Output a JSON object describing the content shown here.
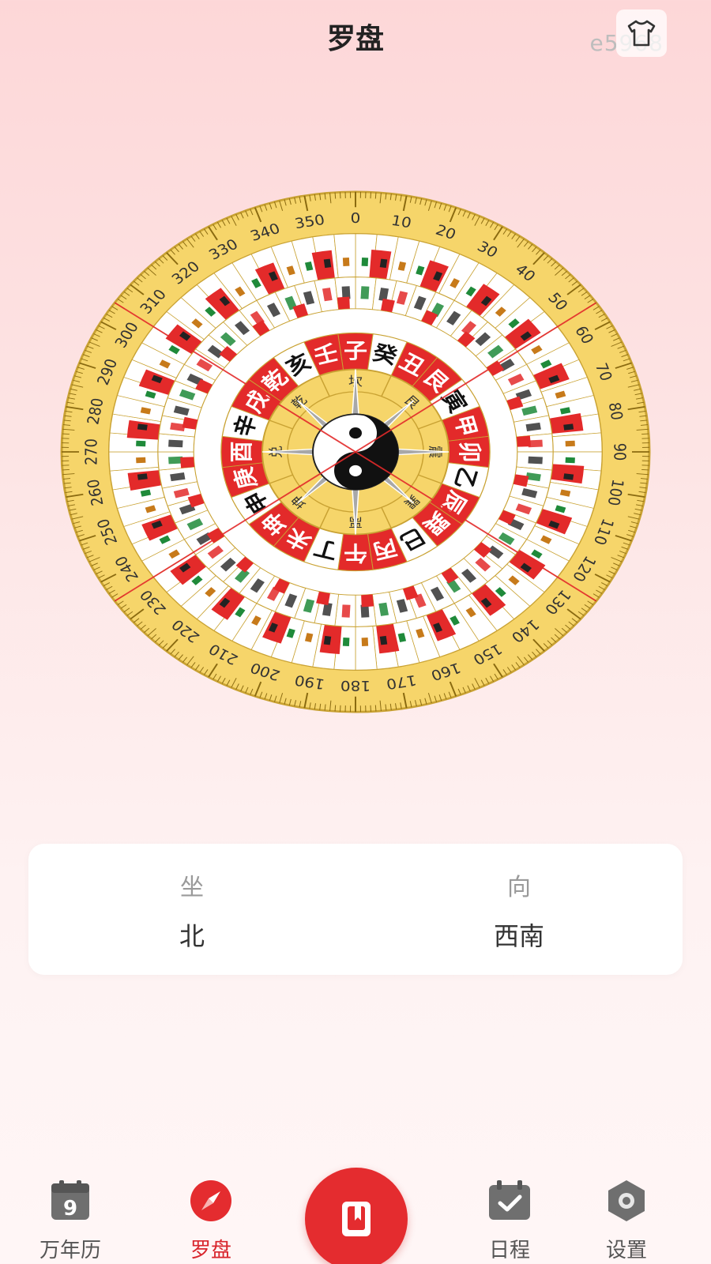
{
  "header": {
    "title": "罗盘",
    "watermark": "e5968"
  },
  "compass": {
    "degree_labels": [
      "0",
      "10",
      "20",
      "30",
      "40",
      "50",
      "60",
      "70",
      "80",
      "90",
      "100",
      "110",
      "120",
      "130",
      "140",
      "150",
      "160",
      "170",
      "180",
      "190",
      "200",
      "210",
      "220",
      "230",
      "240",
      "250",
      "260",
      "270",
      "280",
      "290",
      "300",
      "310",
      "320",
      "330",
      "340",
      "350"
    ],
    "mountains": [
      "子",
      "癸",
      "丑",
      "艮",
      "寅",
      "甲",
      "卯",
      "乙",
      "辰",
      "巽",
      "巳",
      "丙",
      "午",
      "丁",
      "未",
      "坤",
      "申",
      "庚",
      "酉",
      "辛",
      "戌",
      "乾",
      "亥",
      "壬"
    ],
    "trigrams": [
      "坎",
      "艮",
      "震",
      "巽",
      "离",
      "坤",
      "兑",
      "乾"
    ],
    "colors": {
      "gold": "#f6d56a",
      "red": "#e32a2a",
      "green": "#1f8a3a"
    }
  },
  "orientation": {
    "sit_label": "坐",
    "sit_value": "北",
    "face_label": "向",
    "face_value": "西南"
  },
  "tabbar": {
    "calendar": "万年历",
    "compass": "罗盘",
    "schedule": "日程",
    "settings": "设置"
  },
  "colors": {
    "accent": "#e42c2f",
    "tab_gray": "#6f6f6f"
  }
}
